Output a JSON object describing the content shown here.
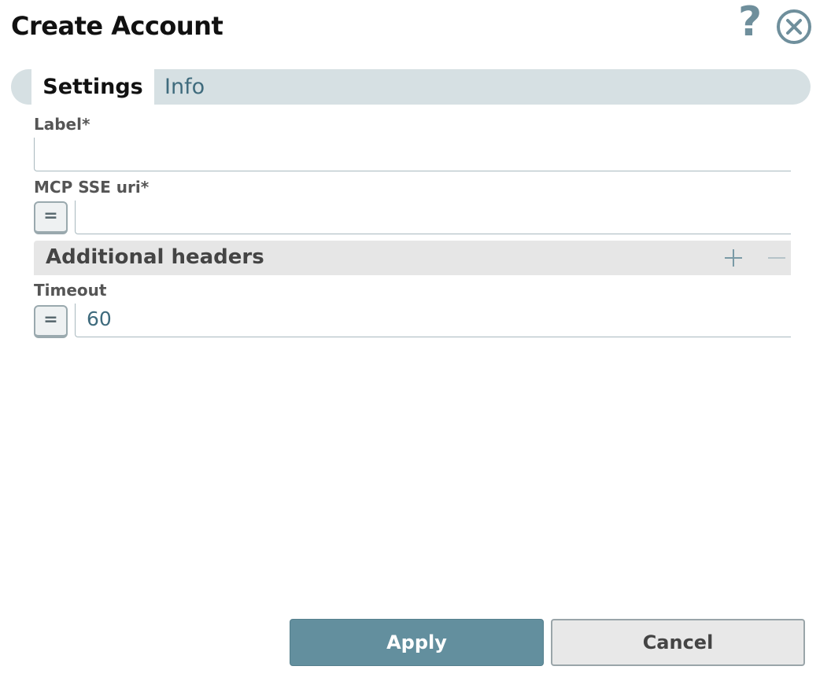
{
  "dialog": {
    "title": "Create Account",
    "help_glyph": "?",
    "icons": {
      "help": "help-icon",
      "close": "close-circle-icon"
    }
  },
  "tabs": [
    {
      "label": "Settings",
      "active": true
    },
    {
      "label": "Info",
      "active": false
    }
  ],
  "form": {
    "label_field": {
      "label": "Label*",
      "value": ""
    },
    "uri_field": {
      "label": "MCP SSE uri*",
      "value": "",
      "expression_glyph": "="
    },
    "additional_headers": {
      "title": "Additional headers",
      "add_icon": "plus-icon",
      "remove_icon": "minus-icon"
    },
    "timeout_field": {
      "label": "Timeout",
      "value": "60",
      "expression_glyph": "="
    }
  },
  "footer": {
    "apply_label": "Apply",
    "cancel_label": "Cancel"
  },
  "colors": {
    "accent": "#638f9e",
    "tab_bar": "#d6e0e3",
    "tab_inactive_text": "#3f6b7d",
    "section_bg": "#e6e6e6"
  }
}
